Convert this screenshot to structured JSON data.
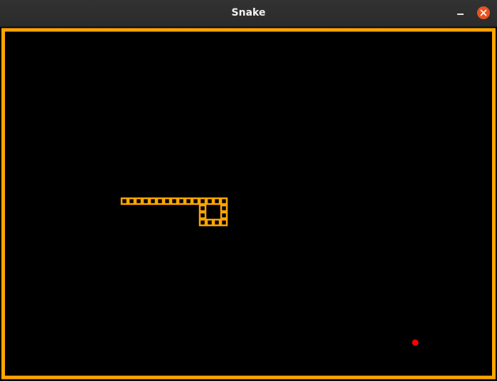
{
  "window": {
    "title": "Snake"
  },
  "colors": {
    "border": "#FFA500",
    "snake": "#FFA500",
    "food": "#FF0000",
    "background": "#000000",
    "close_button": "#E95420"
  },
  "icons": {
    "minimize": "minimize-icon",
    "close": "close-icon"
  },
  "game": {
    "cell_size": 10,
    "snake_segments": [
      [
        17,
        24
      ],
      [
        18,
        24
      ],
      [
        19,
        24
      ],
      [
        20,
        24
      ],
      [
        21,
        24
      ],
      [
        22,
        24
      ],
      [
        23,
        24
      ],
      [
        24,
        24
      ],
      [
        25,
        24
      ],
      [
        26,
        24
      ],
      [
        27,
        24
      ],
      [
        28,
        24
      ],
      [
        29,
        24
      ],
      [
        30,
        24
      ],
      [
        31,
        24
      ],
      [
        31,
        25
      ],
      [
        31,
        26
      ],
      [
        31,
        27
      ],
      [
        30,
        27
      ],
      [
        29,
        27
      ],
      [
        28,
        27
      ],
      [
        28,
        26
      ],
      [
        28,
        25
      ]
    ],
    "food": [
      58,
      44
    ]
  }
}
